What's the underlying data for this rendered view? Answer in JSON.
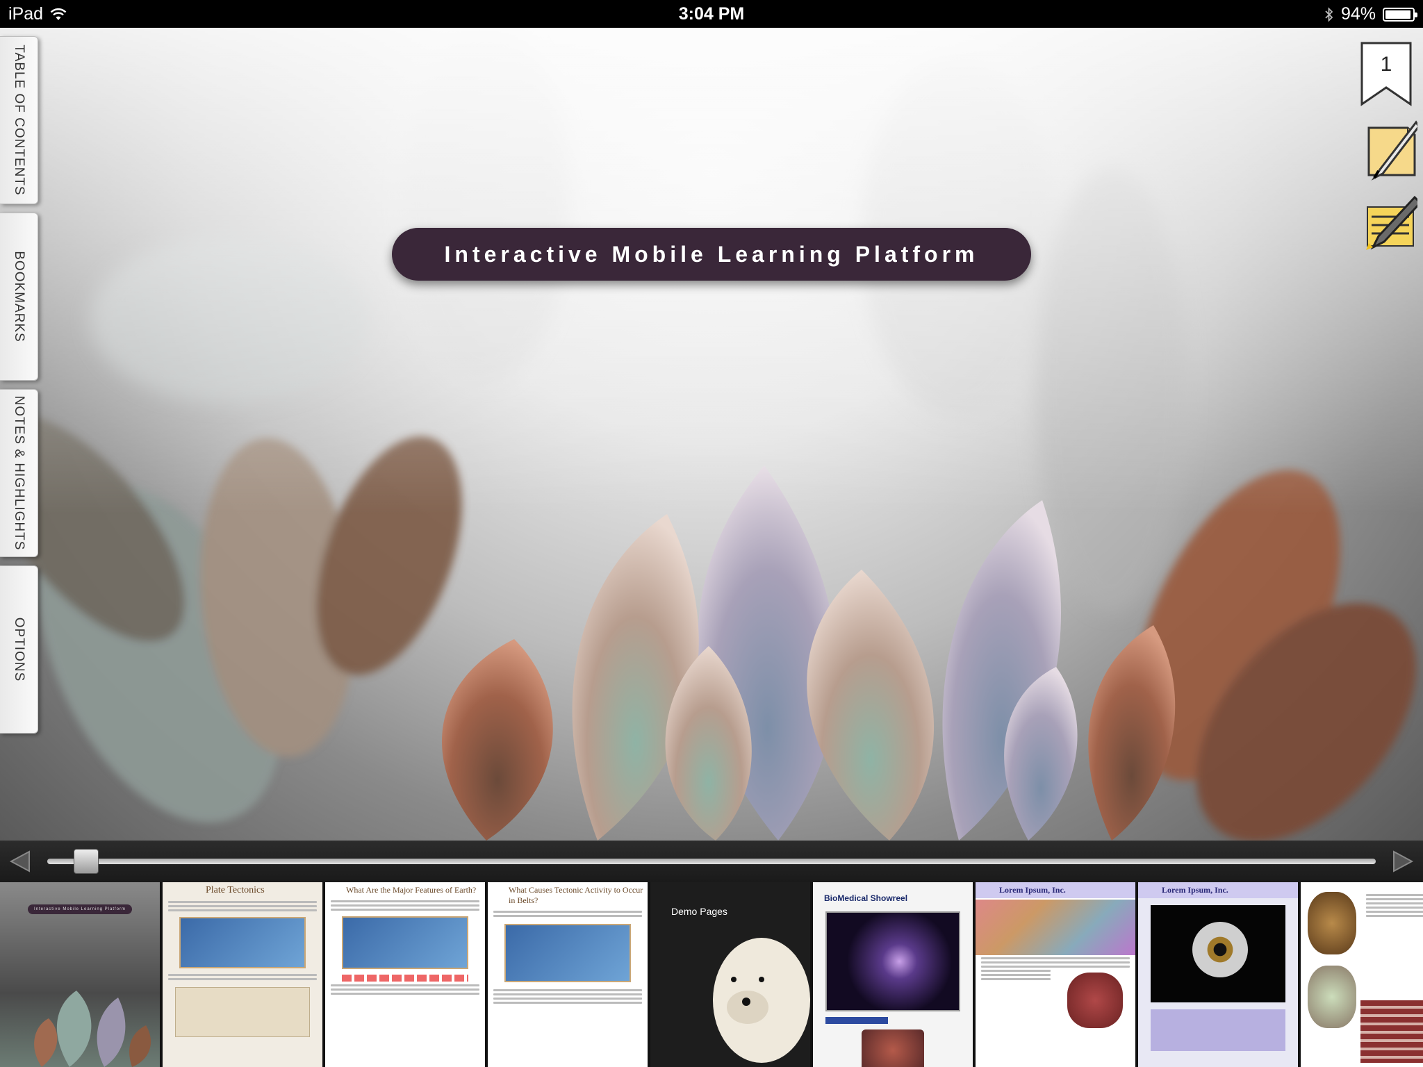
{
  "status_bar": {
    "device": "iPad",
    "time": "3:04 PM",
    "battery": "94%",
    "battery_level": 0.94
  },
  "title": "Interactive Mobile Learning Platform",
  "side_tabs": [
    {
      "label": "TABLE OF CONTENTS"
    },
    {
      "label": "BOOKMARKS"
    },
    {
      "label": "NOTES & HIGHLIGHTS"
    },
    {
      "label": "OPTIONS"
    }
  ],
  "tools": {
    "bookmark_count": "1",
    "note_icon": "pen-note-icon",
    "highlight_icon": "highlighter-icon"
  },
  "scrubber": {
    "position": 0.02
  },
  "thumbnails": [
    {
      "title": "Interactive Mobile Learning Platform"
    },
    {
      "title": "Plate Tectonics"
    },
    {
      "title": "What Are the Major Features of Earth?"
    },
    {
      "title": "What Causes Tectonic Activity to Occur in Belts?"
    },
    {
      "title": "Demo Pages"
    },
    {
      "title": "BioMedical Showreel"
    },
    {
      "title": "Lorem Ipsum, Inc."
    },
    {
      "title": "Lorem Ipsum, Inc."
    },
    {
      "title": ""
    }
  ],
  "colors": {
    "title_pill": "#3a2739",
    "status_bar": "#000000",
    "tab_bg": "#f2f2f2"
  }
}
